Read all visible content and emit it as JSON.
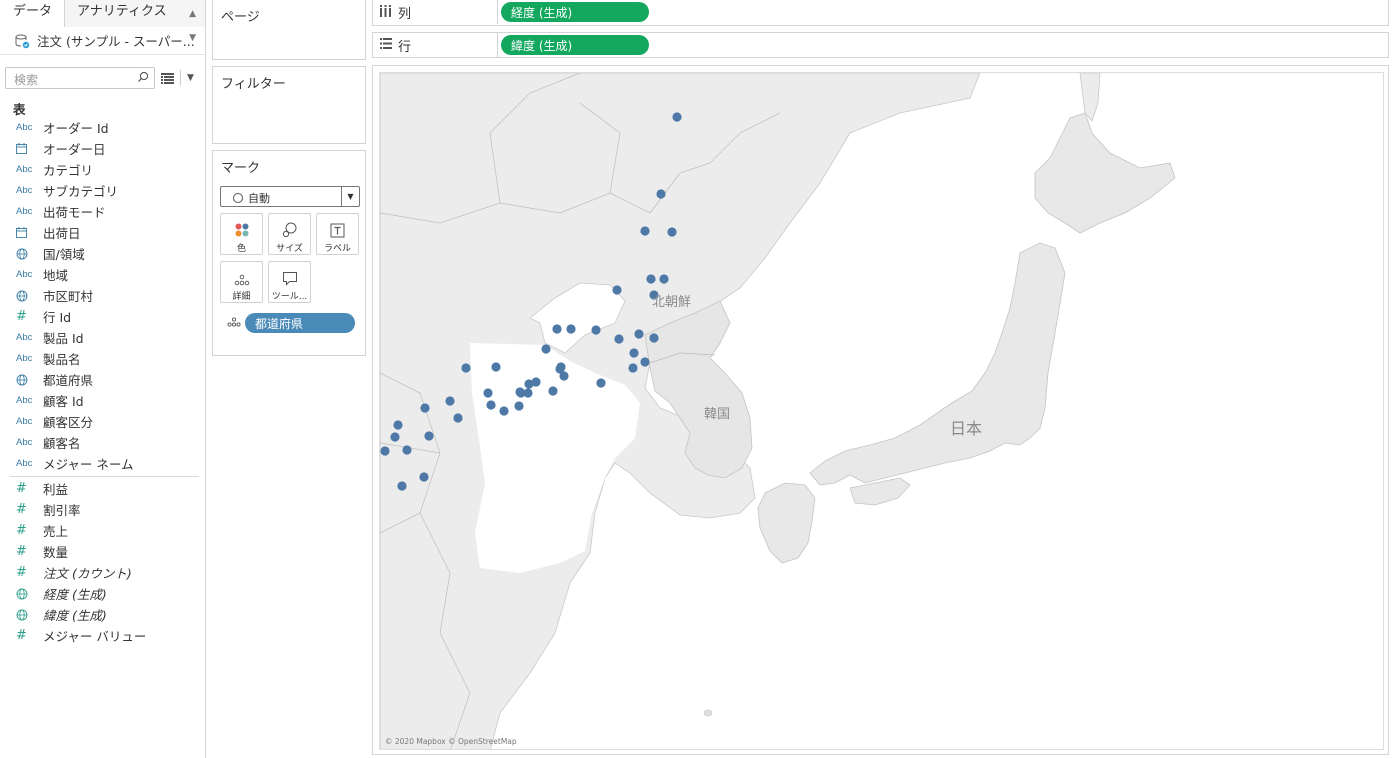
{
  "data_pane": {
    "tab_data": "データ",
    "tab_analytics": "アナリティクス",
    "datasource": "注文 (サンプル - スーパー...",
    "search_placeholder": "検索",
    "section_table": "表",
    "dimensions": [
      {
        "type": "abc",
        "label": "オーダー Id"
      },
      {
        "type": "date",
        "label": "オーダー日"
      },
      {
        "type": "abc",
        "label": "カテゴリ"
      },
      {
        "type": "abc",
        "label": "サブカテゴリ"
      },
      {
        "type": "abc",
        "label": "出荷モード"
      },
      {
        "type": "date",
        "label": "出荷日"
      },
      {
        "type": "globe",
        "label": "国/領域"
      },
      {
        "type": "abc",
        "label": "地域"
      },
      {
        "type": "globe",
        "label": "市区町村"
      },
      {
        "type": "hash",
        "label": "行 Id"
      },
      {
        "type": "abc",
        "label": "製品 Id"
      },
      {
        "type": "abc",
        "label": "製品名"
      },
      {
        "type": "globe",
        "label": "都道府県"
      },
      {
        "type": "abc",
        "label": "顧客 Id"
      },
      {
        "type": "abc",
        "label": "顧客区分"
      },
      {
        "type": "abc",
        "label": "顧客名"
      },
      {
        "type": "abc",
        "label": "メジャー ネーム"
      }
    ],
    "measures": [
      {
        "type": "hash",
        "label": "利益"
      },
      {
        "type": "hash",
        "label": "割引率"
      },
      {
        "type": "hash",
        "label": "売上"
      },
      {
        "type": "hash",
        "label": "数量"
      },
      {
        "type": "hash",
        "label": "注文 (カウント)"
      },
      {
        "type": "globe",
        "label": "経度 (生成)"
      },
      {
        "type": "globe",
        "label": "緯度 (生成)"
      },
      {
        "type": "hash",
        "label": "メジャー バリュー"
      }
    ]
  },
  "pages": {
    "title": "ページ"
  },
  "filters": {
    "title": "フィルター"
  },
  "marks": {
    "title": "マーク",
    "mark_type": "自動",
    "buttons": {
      "color": "色",
      "size": "サイズ",
      "label": "ラベル",
      "detail": "詳細",
      "tooltip": "ツール..."
    },
    "detail_pill": "都道府県"
  },
  "shelves": {
    "columns_label": "列",
    "columns_pill": "経度 (生成)",
    "rows_label": "行",
    "rows_pill": "緯度 (生成)"
  },
  "map": {
    "labels": {
      "north_korea": "北朝鮮",
      "south_korea": "韓国",
      "japan": "日本"
    },
    "attribution": "© 2020 Mapbox © OpenStreetMap",
    "point_color": "#4e79a7"
  }
}
